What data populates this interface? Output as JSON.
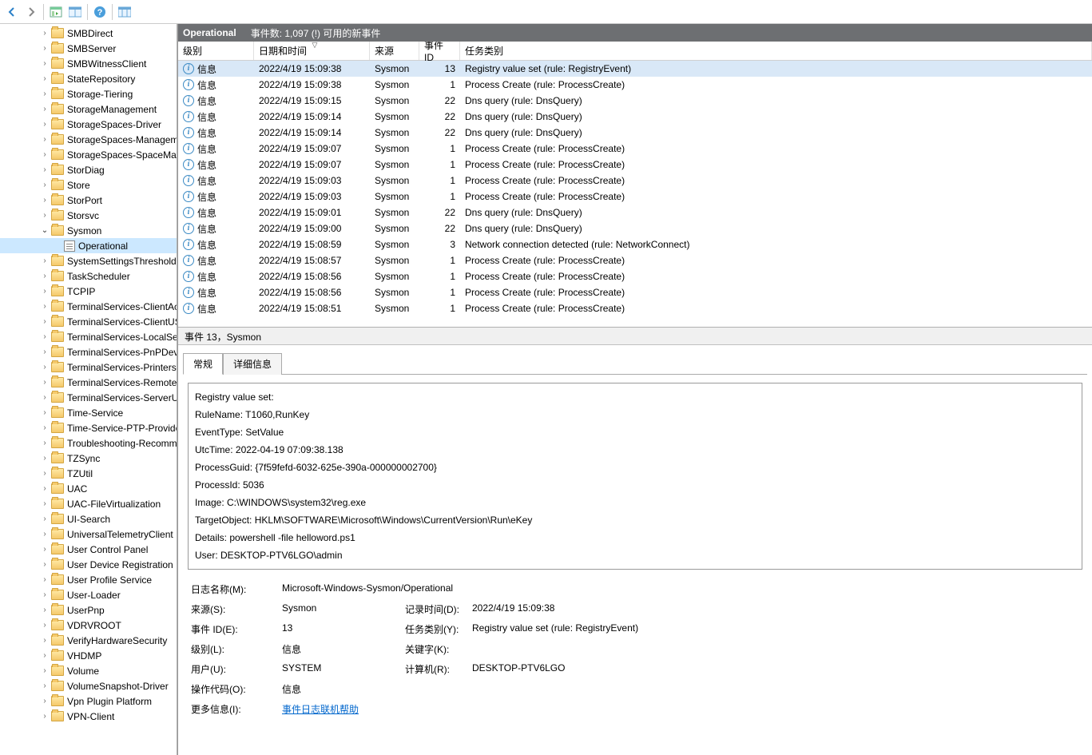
{
  "header": {
    "title": "Operational",
    "subtitle": "事件数: 1,097 (!) 可用的新事件"
  },
  "grid": {
    "columns": {
      "level": "级别",
      "date": "日期和时间",
      "source": "来源",
      "eid": "事件 ID",
      "category": "任务类别"
    },
    "rows": [
      {
        "level": "信息",
        "date": "2022/4/19 15:09:38",
        "src": "Sysmon",
        "eid": "13",
        "cat": "Registry value set (rule: RegistryEvent)",
        "sel": true
      },
      {
        "level": "信息",
        "date": "2022/4/19 15:09:38",
        "src": "Sysmon",
        "eid": "1",
        "cat": "Process Create (rule: ProcessCreate)"
      },
      {
        "level": "信息",
        "date": "2022/4/19 15:09:15",
        "src": "Sysmon",
        "eid": "22",
        "cat": "Dns query (rule: DnsQuery)"
      },
      {
        "level": "信息",
        "date": "2022/4/19 15:09:14",
        "src": "Sysmon",
        "eid": "22",
        "cat": "Dns query (rule: DnsQuery)"
      },
      {
        "level": "信息",
        "date": "2022/4/19 15:09:14",
        "src": "Sysmon",
        "eid": "22",
        "cat": "Dns query (rule: DnsQuery)"
      },
      {
        "level": "信息",
        "date": "2022/4/19 15:09:07",
        "src": "Sysmon",
        "eid": "1",
        "cat": "Process Create (rule: ProcessCreate)"
      },
      {
        "level": "信息",
        "date": "2022/4/19 15:09:07",
        "src": "Sysmon",
        "eid": "1",
        "cat": "Process Create (rule: ProcessCreate)"
      },
      {
        "level": "信息",
        "date": "2022/4/19 15:09:03",
        "src": "Sysmon",
        "eid": "1",
        "cat": "Process Create (rule: ProcessCreate)"
      },
      {
        "level": "信息",
        "date": "2022/4/19 15:09:03",
        "src": "Sysmon",
        "eid": "1",
        "cat": "Process Create (rule: ProcessCreate)"
      },
      {
        "level": "信息",
        "date": "2022/4/19 15:09:01",
        "src": "Sysmon",
        "eid": "22",
        "cat": "Dns query (rule: DnsQuery)"
      },
      {
        "level": "信息",
        "date": "2022/4/19 15:09:00",
        "src": "Sysmon",
        "eid": "22",
        "cat": "Dns query (rule: DnsQuery)"
      },
      {
        "level": "信息",
        "date": "2022/4/19 15:08:59",
        "src": "Sysmon",
        "eid": "3",
        "cat": "Network connection detected (rule: NetworkConnect)"
      },
      {
        "level": "信息",
        "date": "2022/4/19 15:08:57",
        "src": "Sysmon",
        "eid": "1",
        "cat": "Process Create (rule: ProcessCreate)"
      },
      {
        "level": "信息",
        "date": "2022/4/19 15:08:56",
        "src": "Sysmon",
        "eid": "1",
        "cat": "Process Create (rule: ProcessCreate)"
      },
      {
        "level": "信息",
        "date": "2022/4/19 15:08:56",
        "src": "Sysmon",
        "eid": "1",
        "cat": "Process Create (rule: ProcessCreate)"
      },
      {
        "level": "信息",
        "date": "2022/4/19 15:08:51",
        "src": "Sysmon",
        "eid": "1",
        "cat": "Process Create (rule: ProcessCreate)"
      }
    ]
  },
  "detail": {
    "caption": "事件 13，Sysmon",
    "tabs": {
      "general": "常规",
      "details": "详细信息"
    },
    "body": "Registry value set:\nRuleName: T1060,RunKey\nEventType: SetValue\nUtcTime: 2022-04-19 07:09:38.138\nProcessGuid: {7f59fefd-6032-625e-390a-000000002700}\nProcessId: 5036\nImage: C:\\WINDOWS\\system32\\reg.exe\nTargetObject: HKLM\\SOFTWARE\\Microsoft\\Windows\\CurrentVersion\\Run\\eKey\nDetails: powershell -file helloword.ps1\nUser: DESKTOP-PTV6LGO\\admin",
    "kv": {
      "logname_l": "日志名称(M):",
      "logname_v": "Microsoft-Windows-Sysmon/Operational",
      "source_l": "来源(S):",
      "source_v": "Sysmon",
      "logged_l": "记录时间(D):",
      "logged_v": "2022/4/19 15:09:38",
      "eid_l": "事件 ID(E):",
      "eid_v": "13",
      "cat_l": "任务类别(Y):",
      "cat_v": "Registry value set (rule: RegistryEvent)",
      "level_l": "级别(L):",
      "level_v": "信息",
      "kw_l": "关键字(K):",
      "kw_v": "",
      "user_l": "用户(U):",
      "user_v": "SYSTEM",
      "comp_l": "计算机(R):",
      "comp_v": "DESKTOP-PTV6LGO",
      "op_l": "操作代码(O):",
      "op_v": "信息",
      "more_l": "更多信息(I):",
      "more_v": "事件日志联机帮助"
    }
  },
  "tree": [
    {
      "label": "SMBDirect",
      "t": "f",
      "a": ">"
    },
    {
      "label": "SMBServer",
      "t": "f",
      "a": ">"
    },
    {
      "label": "SMBWitnessClient",
      "t": "f",
      "a": ">"
    },
    {
      "label": "StateRepository",
      "t": "f",
      "a": ">"
    },
    {
      "label": "Storage-Tiering",
      "t": "f",
      "a": ">"
    },
    {
      "label": "StorageManagement",
      "t": "f",
      "a": ">"
    },
    {
      "label": "StorageSpaces-Driver",
      "t": "f",
      "a": ">"
    },
    {
      "label": "StorageSpaces-ManagementAgent",
      "t": "f",
      "a": ">"
    },
    {
      "label": "StorageSpaces-SpaceManager",
      "t": "f",
      "a": ">"
    },
    {
      "label": "StorDiag",
      "t": "f",
      "a": ">"
    },
    {
      "label": "Store",
      "t": "f",
      "a": ">"
    },
    {
      "label": "StorPort",
      "t": "f",
      "a": ">"
    },
    {
      "label": "Storsvc",
      "t": "f",
      "a": ">"
    },
    {
      "label": "Sysmon",
      "t": "f",
      "a": "v"
    },
    {
      "label": "Operational",
      "t": "l",
      "a": "",
      "lvl": 2,
      "sel": true
    },
    {
      "label": "SystemSettingsThreshold",
      "t": "f",
      "a": ">"
    },
    {
      "label": "TaskScheduler",
      "t": "f",
      "a": ">"
    },
    {
      "label": "TCPIP",
      "t": "f",
      "a": ">"
    },
    {
      "label": "TerminalServices-ClientActiveXCore",
      "t": "f",
      "a": ">"
    },
    {
      "label": "TerminalServices-ClientUSBDevices",
      "t": "f",
      "a": ">"
    },
    {
      "label": "TerminalServices-LocalSessionManager",
      "t": "f",
      "a": ">"
    },
    {
      "label": "TerminalServices-PnPDevices",
      "t": "f",
      "a": ">"
    },
    {
      "label": "TerminalServices-Printers",
      "t": "f",
      "a": ">"
    },
    {
      "label": "TerminalServices-RemoteConnectionManager",
      "t": "f",
      "a": ">"
    },
    {
      "label": "TerminalServices-ServerUSBDevices",
      "t": "f",
      "a": ">"
    },
    {
      "label": "Time-Service",
      "t": "f",
      "a": ">"
    },
    {
      "label": "Time-Service-PTP-Provider",
      "t": "f",
      "a": ">"
    },
    {
      "label": "Troubleshooting-Recommended",
      "t": "f",
      "a": ">"
    },
    {
      "label": "TZSync",
      "t": "f",
      "a": ">"
    },
    {
      "label": "TZUtil",
      "t": "f",
      "a": ">"
    },
    {
      "label": "UAC",
      "t": "f",
      "a": ">"
    },
    {
      "label": "UAC-FileVirtualization",
      "t": "f",
      "a": ">"
    },
    {
      "label": "UI-Search",
      "t": "f",
      "a": ">"
    },
    {
      "label": "UniversalTelemetryClient",
      "t": "f",
      "a": ">"
    },
    {
      "label": "User Control Panel",
      "t": "f",
      "a": ">"
    },
    {
      "label": "User Device Registration",
      "t": "f",
      "a": ">"
    },
    {
      "label": "User Profile Service",
      "t": "f",
      "a": ">"
    },
    {
      "label": "User-Loader",
      "t": "f",
      "a": ">"
    },
    {
      "label": "UserPnp",
      "t": "f",
      "a": ">"
    },
    {
      "label": "VDRVROOT",
      "t": "f",
      "a": ">"
    },
    {
      "label": "VerifyHardwareSecurity",
      "t": "f",
      "a": ">"
    },
    {
      "label": "VHDMP",
      "t": "f",
      "a": ">"
    },
    {
      "label": "Volume",
      "t": "f",
      "a": ">"
    },
    {
      "label": "VolumeSnapshot-Driver",
      "t": "f",
      "a": ">"
    },
    {
      "label": "Vpn Plugin Platform",
      "t": "f",
      "a": ">"
    },
    {
      "label": "VPN-Client",
      "t": "f",
      "a": ">"
    }
  ]
}
